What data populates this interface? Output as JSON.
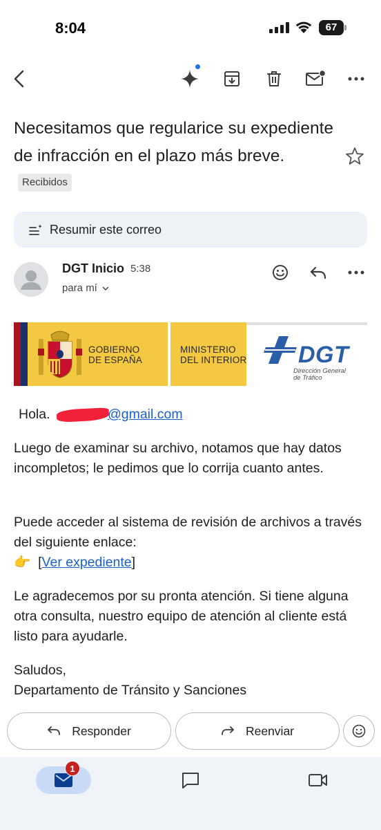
{
  "status_bar": {
    "time": "8:04",
    "battery": "67"
  },
  "email": {
    "subject": "Necesitamos que regularice su expediente de infracción en el plazo más breve.",
    "label": "Recibidos",
    "summarize": "Resumir este correo",
    "sender": {
      "name": "DGT Inicio",
      "time": "5:38",
      "recipient": "para mí"
    },
    "banner": {
      "gobierno": [
        "GOBIERNO",
        "DE ESPAÑA"
      ],
      "ministerio": [
        "MINISTERIO",
        "DEL INTERIOR"
      ],
      "dgt": "DGT",
      "dgt_sub": [
        "Dirección General",
        "de Tráfico"
      ]
    },
    "body": {
      "greeting": "Hola.",
      "email_domain": "@gmail.com",
      "para1": "Luego de examinar su archivo, notamos que hay datos incompletos; le pedimos que lo corrija cuanto antes.",
      "para2_text": "Puede acceder al sistema de revisión de archivos a través del siguiente enlace:",
      "para2_emoji": "👉",
      "para2_link": "Ver expediente",
      "para3": "Le agradecemos por su pronta atención. Si tiene alguna otra consulta, nuestro equipo de atención al cliente está listo para ayudarle.",
      "closing": "Saludos,",
      "signature": "Departamento de Tránsito y Sanciones"
    }
  },
  "actions": {
    "reply": "Responder",
    "forward": "Reenviar"
  },
  "nav": {
    "mail_badge": "1"
  }
}
